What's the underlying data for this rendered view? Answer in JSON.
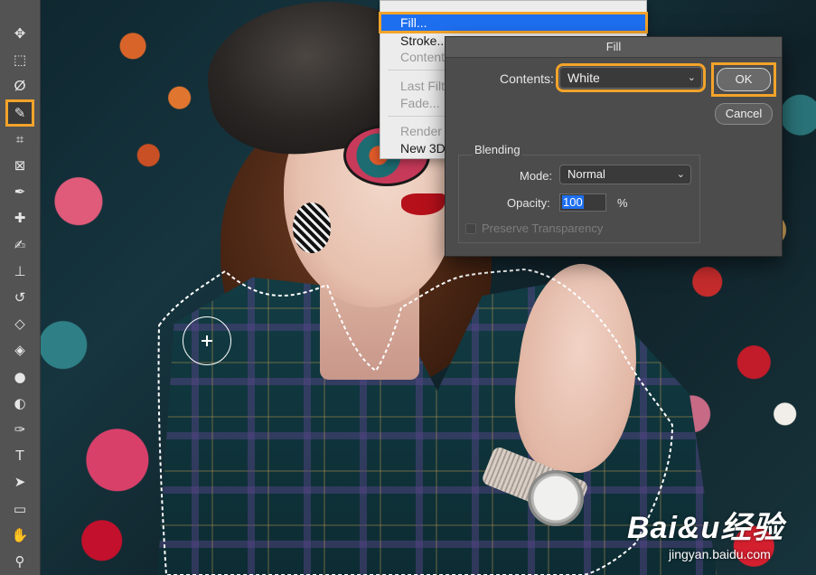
{
  "toolbar": {
    "tools": [
      {
        "name": "move-tool",
        "glyph": "✥"
      },
      {
        "name": "marquee-tool",
        "glyph": "⬚"
      },
      {
        "name": "lasso-tool",
        "glyph": "ⵁ"
      },
      {
        "name": "quick-selection-tool",
        "glyph": "✎",
        "active": true
      },
      {
        "name": "crop-tool",
        "glyph": "⌗"
      },
      {
        "name": "frame-tool",
        "glyph": "⊠"
      },
      {
        "name": "eyedropper-tool",
        "glyph": "✒"
      },
      {
        "name": "healing-brush-tool",
        "glyph": "✚"
      },
      {
        "name": "brush-tool",
        "glyph": "✍"
      },
      {
        "name": "clone-stamp-tool",
        "glyph": "⊥"
      },
      {
        "name": "history-brush-tool",
        "glyph": "↺"
      },
      {
        "name": "eraser-tool",
        "glyph": "◇"
      },
      {
        "name": "paint-bucket-tool",
        "glyph": "◈"
      },
      {
        "name": "blur-tool",
        "glyph": "●"
      },
      {
        "name": "dodge-tool",
        "glyph": "◐"
      },
      {
        "name": "pen-tool",
        "glyph": "✑"
      },
      {
        "name": "type-tool",
        "glyph": "T"
      },
      {
        "name": "path-selection-tool",
        "glyph": "➤"
      },
      {
        "name": "rectangle-tool",
        "glyph": "▭"
      },
      {
        "name": "hand-tool",
        "glyph": "✋"
      },
      {
        "name": "zoom-tool",
        "glyph": "⚲"
      }
    ]
  },
  "edit_menu": {
    "items": [
      {
        "label": "Fill...",
        "state": "selected"
      },
      {
        "label": "Stroke...",
        "state": "enabled"
      },
      {
        "label": "Content",
        "state": "disabled"
      },
      {
        "label": "Last Filt",
        "state": "disabled"
      },
      {
        "label": "Fade...",
        "state": "disabled"
      },
      {
        "label": "Render",
        "state": "disabled"
      },
      {
        "label": "New 3D",
        "state": "enabled"
      }
    ]
  },
  "fill_dialog": {
    "title": "Fill",
    "contents_label": "Contents:",
    "contents_value": "White",
    "ok_label": "OK",
    "cancel_label": "Cancel",
    "blending_label": "Blending",
    "mode_label": "Mode:",
    "mode_value": "Normal",
    "opacity_label": "Opacity:",
    "opacity_value": "100",
    "opacity_unit": "%",
    "preserve_transparency_label": "Preserve Transparency",
    "preserve_transparency_checked": false
  },
  "watermark": {
    "logo": "Bai&u经验",
    "url": "jingyan.baidu.com"
  },
  "colors": {
    "highlight": "#f3a32a",
    "menu_selected": "#1e6ff0",
    "dialog_bg": "#4c4c4c",
    "toolbar_bg": "#535353"
  }
}
